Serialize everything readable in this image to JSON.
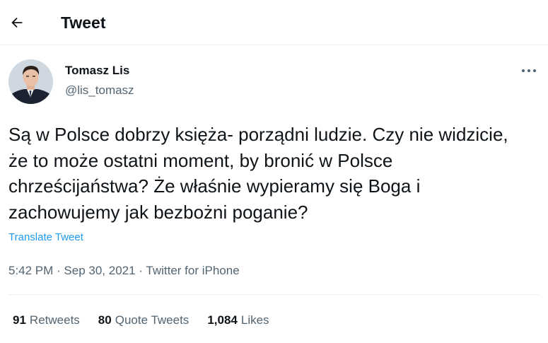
{
  "header": {
    "title": "Tweet",
    "back_icon": "arrow-left-icon"
  },
  "author": {
    "name": "Tomasz Lis",
    "handle": "@lis_tomasz"
  },
  "tweet": {
    "text": "Są w Polsce dobrzy księża- porządni ludzie. Czy nie widzicie, że to może ostatni moment, by bronić w Polsce chrześcijaństwa? Że właśnie wypieramy się Boga i zachowujemy jak bezbożni poganie?",
    "translate_label": "Translate Tweet",
    "time": "5:42 PM",
    "date": "Sep 30, 2021",
    "source": "Twitter for iPhone",
    "separator": " · "
  },
  "stats": {
    "retweets_count": "91",
    "retweets_label": "Retweets",
    "quotes_count": "80",
    "quotes_label": "Quote Tweets",
    "likes_count": "1,084",
    "likes_label": "Likes"
  },
  "colors": {
    "accent": "#1d9bf0",
    "secondary_text": "#536471",
    "primary_text": "#0f1419"
  }
}
